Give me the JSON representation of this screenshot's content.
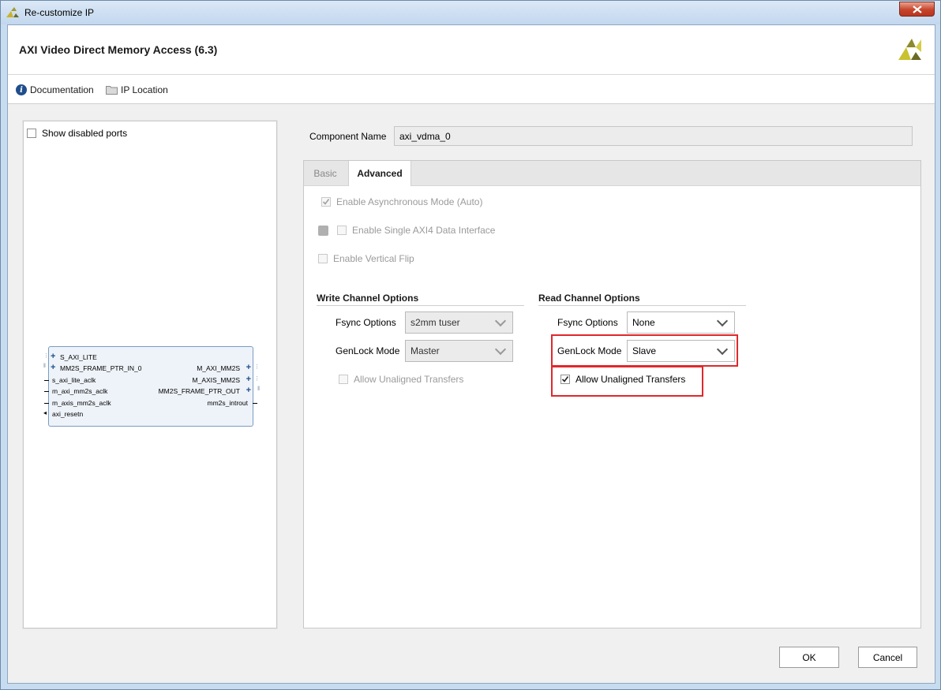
{
  "window": {
    "title": "Re-customize IP"
  },
  "header": {
    "ip_title": "AXI Video Direct Memory Access (6.3)"
  },
  "toolbar": {
    "documentation": "Documentation",
    "ip_location": "IP Location"
  },
  "left_panel": {
    "show_disabled_ports": "Show disabled ports",
    "block": {
      "left_ports": [
        "S_AXI_LITE",
        "MM2S_FRAME_PTR_IN_0",
        "s_axi_lite_aclk",
        "m_axi_mm2s_aclk",
        "m_axis_mm2s_aclk",
        "axi_resetn"
      ],
      "right_ports": [
        "M_AXI_MM2S",
        "M_AXIS_MM2S",
        "MM2S_FRAME_PTR_OUT",
        "mm2s_introut"
      ]
    }
  },
  "component": {
    "label": "Component Name",
    "value": "axi_vdma_0"
  },
  "tabs": {
    "basic": "Basic",
    "advanced": "Advanced"
  },
  "advanced": {
    "async_mode": "Enable Asynchronous Mode (Auto)",
    "single_axi4": "Enable Single AXI4 Data Interface",
    "vertical_flip": "Enable Vertical Flip",
    "write_channel": {
      "title": "Write Channel Options",
      "fsync_label": "Fsync Options",
      "fsync_value": "s2mm tuser",
      "genlock_label": "GenLock Mode",
      "genlock_value": "Master",
      "unaligned": "Allow Unaligned Transfers"
    },
    "read_channel": {
      "title": "Read Channel Options",
      "fsync_label": "Fsync Options",
      "fsync_value": "None",
      "genlock_label": "GenLock Mode",
      "genlock_value": "Slave",
      "unaligned": "Allow Unaligned Transfers"
    }
  },
  "buttons": {
    "ok": "OK",
    "cancel": "Cancel"
  },
  "colors": {
    "highlight": "#e0282b",
    "brand": "#b5b52b"
  }
}
